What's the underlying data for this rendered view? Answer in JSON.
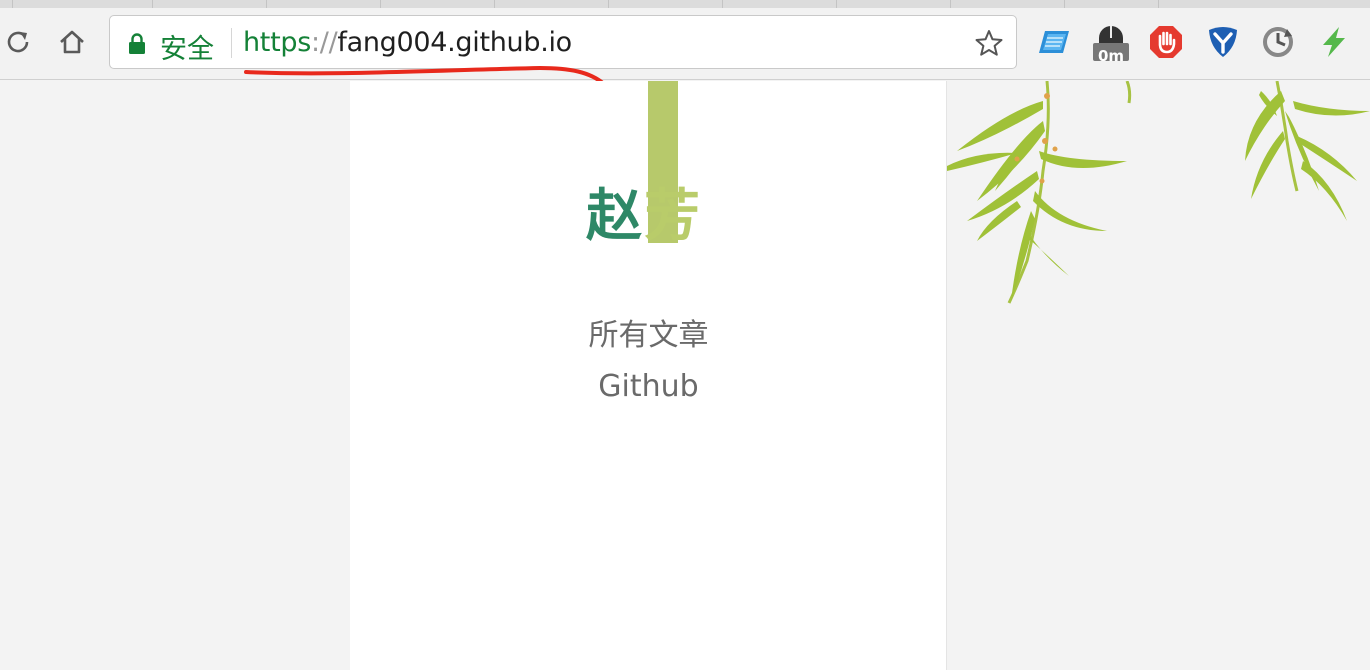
{
  "browser": {
    "security_label": "安全",
    "url": {
      "scheme": "https",
      "separator": "://",
      "host": "fang004.github.io"
    },
    "extension_badge": "0m"
  },
  "site": {
    "title_first": "赵",
    "title_second": "芳",
    "nav": [
      {
        "label": "所有文章"
      },
      {
        "label": "Github"
      }
    ]
  },
  "colors": {
    "secure_green": "#148137",
    "title_dark_green": "#2e8867",
    "title_light_green": "#b9cc6a",
    "bamboo_bar": "#b7c96b",
    "annotation_red": "#e8291c"
  }
}
